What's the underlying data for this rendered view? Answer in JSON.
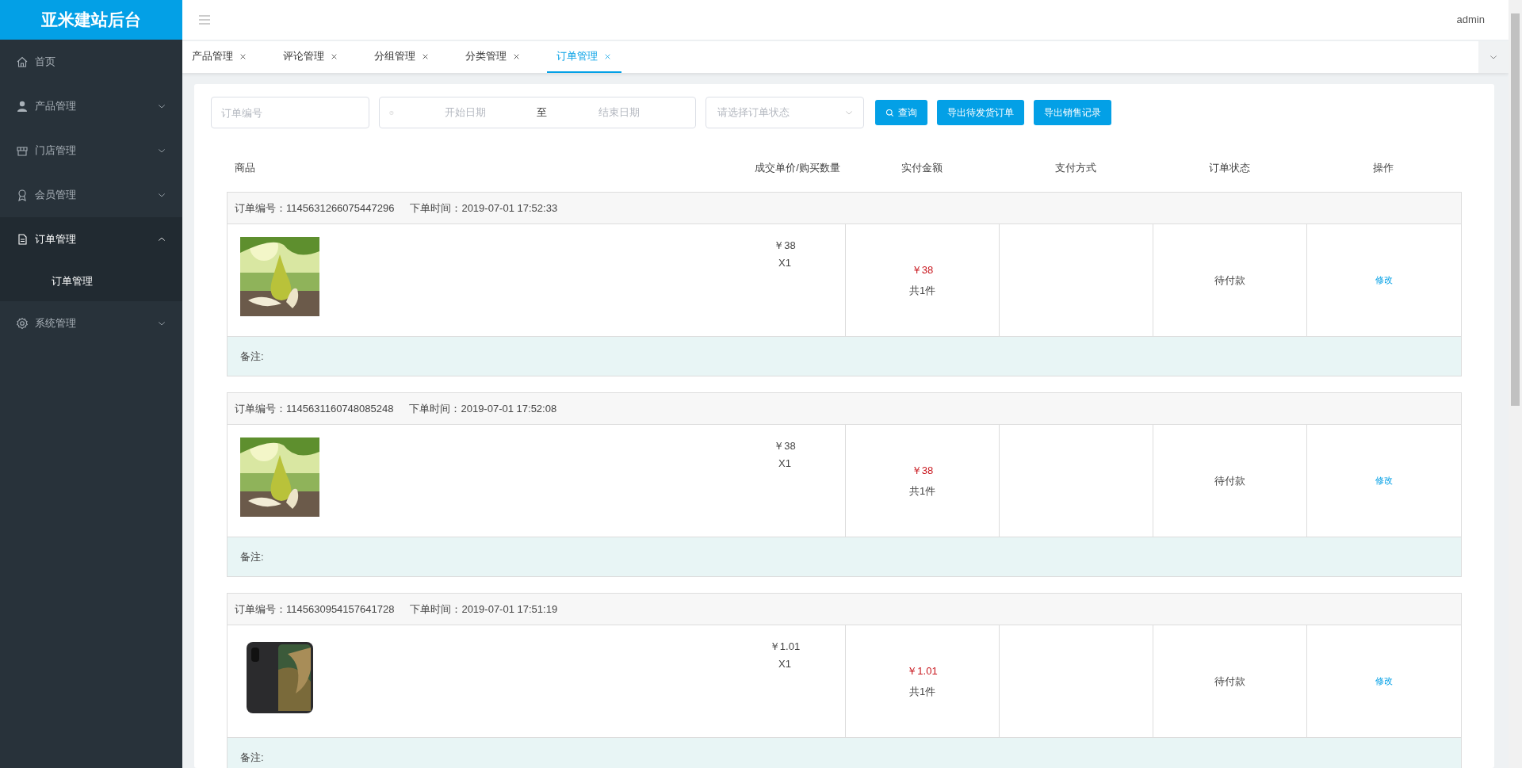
{
  "sidebar": {
    "title": "亚米建站后台",
    "items": [
      {
        "label": "首页",
        "kind": "link"
      },
      {
        "label": "产品管理",
        "kind": "group",
        "expanded": false
      },
      {
        "label": "门店管理",
        "kind": "group",
        "expanded": false
      },
      {
        "label": "会员管理",
        "kind": "group",
        "expanded": false
      },
      {
        "label": "订单管理",
        "kind": "group",
        "expanded": true,
        "children": [
          {
            "label": "订单管理",
            "selected": true
          }
        ]
      },
      {
        "label": "系统管理",
        "kind": "group",
        "expanded": false
      }
    ]
  },
  "header": {
    "user": "admin"
  },
  "tabs": [
    {
      "label": "产品管理",
      "selected": false
    },
    {
      "label": "评论管理",
      "selected": false
    },
    {
      "label": "分组管理",
      "selected": false
    },
    {
      "label": "分类管理",
      "selected": false
    },
    {
      "label": "订单管理",
      "selected": true
    }
  ],
  "filters": {
    "order_no": {
      "placeholder": "订单编号"
    },
    "date_start": {
      "placeholder": "开始日期"
    },
    "date_separator": "至",
    "date_end": {
      "placeholder": "结束日期"
    },
    "status": {
      "placeholder": "请选择订单状态"
    }
  },
  "buttons": [
    {
      "label": "查询",
      "kind": "search"
    },
    {
      "label": "导出待发货订单",
      "kind": "plain"
    },
    {
      "label": "导出销售记录",
      "kind": "plain"
    }
  ],
  "table": {
    "columns": [
      "商品",
      "成交单价/购买数量",
      "实付金额",
      "支付方式",
      "订单状态",
      "操作"
    ],
    "orders": [
      {
        "order_no_label": "订单编号：",
        "order_no": "1145631266075447296",
        "time_label": "下单时间：",
        "time": "2019-07-01 17:52:33",
        "unit_price": "￥38",
        "quantity": "X1",
        "paid": "￥38",
        "count": "共1件",
        "status": "待付款",
        "action": "修改",
        "remark_label": "备注:"
      },
      {
        "order_no_label": "订单编号：",
        "order_no": "1145631160748085248",
        "time_label": "下单时间：",
        "time": "2019-07-01 17:52:08",
        "unit_price": "￥38",
        "quantity": "X1",
        "paid": "￥38",
        "count": "共1件",
        "status": "待付款",
        "action": "修改",
        "remark_label": "备注:"
      },
      {
        "order_no_label": "订单编号：",
        "order_no": "1145630954157641728",
        "time_label": "下单时间：",
        "time": "2019-07-01 17:51:19",
        "unit_price": "￥1.01",
        "quantity": "X1",
        "paid": "￥1.01",
        "count": "共1件",
        "status": "待付款",
        "action": "修改",
        "remark_label": "备注:"
      }
    ]
  }
}
